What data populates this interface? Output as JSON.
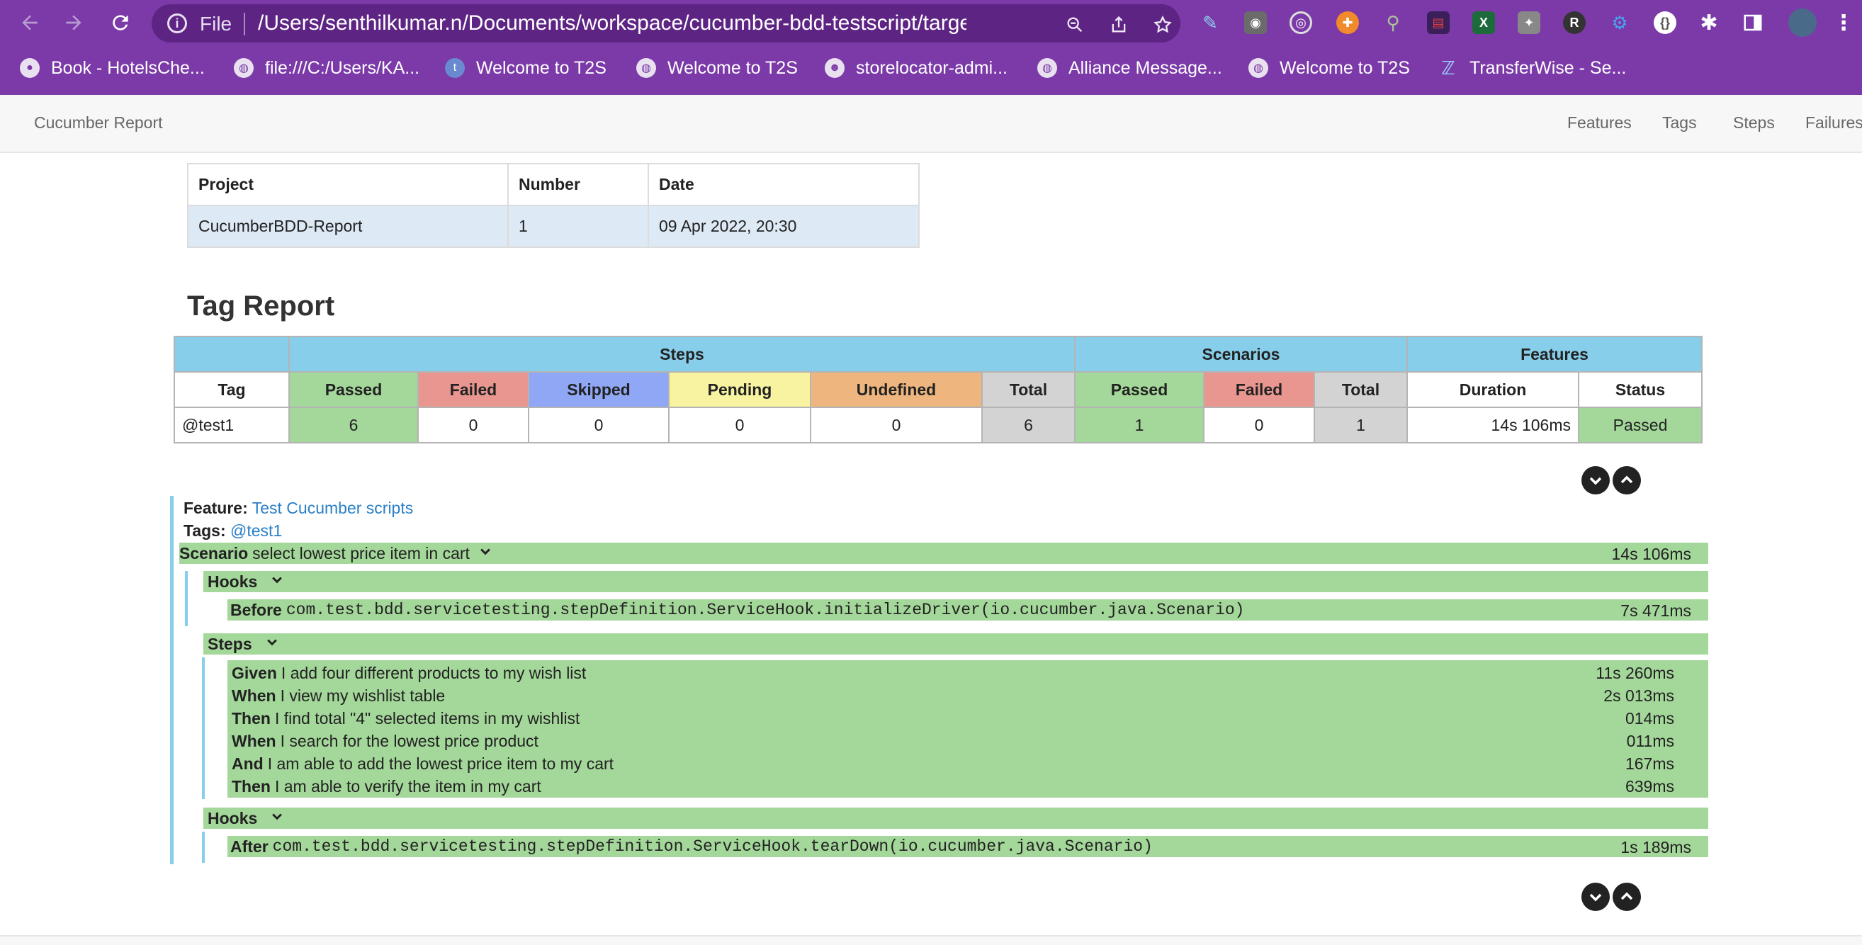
{
  "browser": {
    "file_label": "File",
    "url": "/Users/senthilkumar.n/Documents/workspace/cucumber-bdd-testscript/target/cu...",
    "bookmarks": [
      "Book - HotelsChe...",
      "file:///C:/Users/KA...",
      "Welcome to T2S",
      "Welcome to T2S",
      "storelocator-admi...",
      "Alliance Message...",
      "Welcome to T2S",
      "TransferWise - Se..."
    ],
    "accent": "#7b3aa8"
  },
  "navbar": {
    "brand": "Cucumber Report",
    "links": [
      "Features",
      "Tags",
      "Steps",
      "Failures"
    ]
  },
  "project_table": {
    "headers": [
      "Project",
      "Number",
      "Date"
    ],
    "row": [
      "CucumberBDD-Report",
      "1",
      "09 Apr 2022, 20:30"
    ]
  },
  "tag_report": {
    "title": "Tag Report",
    "groups": [
      "Steps",
      "Scenarios",
      "Features"
    ],
    "columns": [
      "Tag",
      "Passed",
      "Failed",
      "Skipped",
      "Pending",
      "Undefined",
      "Total",
      "Passed",
      "Failed",
      "Total",
      "Duration",
      "Status"
    ],
    "row": [
      "@test1",
      "6",
      "0",
      "0",
      "0",
      "0",
      "6",
      "1",
      "0",
      "1",
      "14s 106ms",
      "Passed"
    ]
  },
  "feature": {
    "feature_label": "Feature:",
    "feature_name": "Test Cucumber scripts",
    "tags_label": "Tags:",
    "tag": "@test1",
    "scenario_label": "Scenario",
    "scenario_name": "select lowest price item in cart",
    "scenario_duration": "14s 106ms",
    "hooks_label": "Hooks",
    "steps_label": "Steps",
    "before": {
      "keyword": "Before",
      "text": "com.test.bdd.servicetesting.stepDefinition.ServiceHook.initializeDriver(io.cucumber.java.Scenario)",
      "duration": "7s 471ms"
    },
    "steps": [
      {
        "keyword": "Given",
        "text": "I add four different products to my wish list",
        "duration": "11s 260ms"
      },
      {
        "keyword": "When",
        "text": "I view my wishlist table",
        "duration": "2s 013ms"
      },
      {
        "keyword": "Then",
        "text": "I find total \"4\" selected items in my wishlist",
        "duration": "014ms"
      },
      {
        "keyword": "When",
        "text": "I search for the lowest price product",
        "duration": "011ms"
      },
      {
        "keyword": "And",
        "text": "I am able to add the lowest price item to my cart",
        "duration": "167ms"
      },
      {
        "keyword": "Then",
        "text": "I am able to verify the item in my cart",
        "duration": "639ms"
      }
    ],
    "after": {
      "keyword": "After",
      "text": "com.test.bdd.servicetesting.stepDefinition.ServiceHook.tearDown(io.cucumber.java.Scenario)",
      "duration": "1s 189ms"
    }
  },
  "colors": {
    "passed": "#a4d79a",
    "failed": "#e8968f",
    "skipped": "#8fa7f5",
    "pending": "#f7f3a0",
    "undefined": "#eeb67e",
    "total": "#d3d3d3",
    "header": "#87ceeb"
  }
}
